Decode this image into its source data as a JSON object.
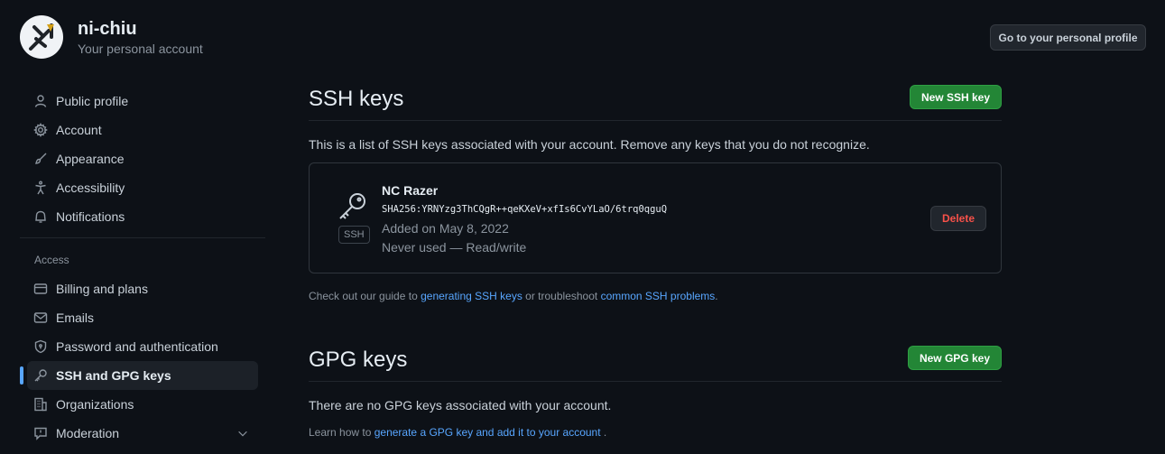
{
  "header": {
    "username": "ni-chiu",
    "subtitle": "Your personal account",
    "profile_button": "Go to your personal profile",
    "avatar_icon": "trident-logo-icon"
  },
  "sidebar": {
    "items": [
      {
        "label": "Public profile",
        "icon": "person-icon"
      },
      {
        "label": "Account",
        "icon": "gear-icon"
      },
      {
        "label": "Appearance",
        "icon": "paintbrush-icon"
      },
      {
        "label": "Accessibility",
        "icon": "accessibility-icon"
      },
      {
        "label": "Notifications",
        "icon": "bell-icon"
      }
    ],
    "access_title": "Access",
    "access_items": [
      {
        "label": "Billing and plans",
        "icon": "credit-card-icon"
      },
      {
        "label": "Emails",
        "icon": "mail-icon"
      },
      {
        "label": "Password and authentication",
        "icon": "shield-lock-icon"
      },
      {
        "label": "SSH and GPG keys",
        "icon": "key-icon",
        "selected": true
      },
      {
        "label": "Organizations",
        "icon": "organization-icon"
      },
      {
        "label": "Moderation",
        "icon": "report-icon"
      }
    ]
  },
  "ssh": {
    "title": "SSH keys",
    "new_button": "New SSH key",
    "description": "This is a list of SSH keys associated with your account. Remove any keys that you do not recognize.",
    "key": {
      "name": "NC Razer",
      "fingerprint": "SHA256:YRNYzg3ThCQgR++qeKXeV+xfIs6CvYLaO/6trq0qguQ",
      "added": "Added on May 8, 2022",
      "used": "Never used — Read/write",
      "badge": "SSH",
      "delete_label": "Delete"
    },
    "guide_prefix": "Check out our guide to",
    "guide_link1": "generating SSH keys",
    "guide_middle": "or troubleshoot",
    "guide_link2": "common SSH problems",
    "guide_suffix": "."
  },
  "gpg": {
    "title": "GPG keys",
    "new_button": "New GPG key",
    "description": "There are no GPG keys associated with your account.",
    "learn_prefix": "Learn how to",
    "learn_link": "generate a GPG key and add it to your account",
    "learn_suffix": "."
  },
  "colors": {
    "background": "#0d1117",
    "accent": "#58a6ff",
    "primary_button": "#238636",
    "danger": "#f85149"
  }
}
